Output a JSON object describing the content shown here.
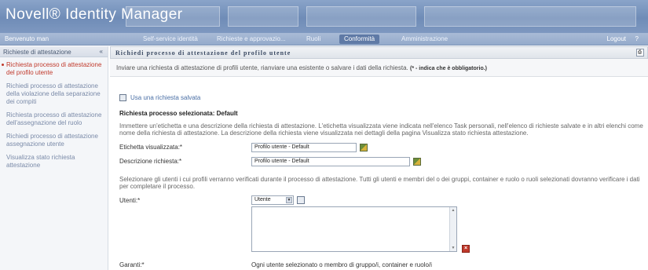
{
  "app": {
    "title": "Novell® Identity Manager"
  },
  "nav": {
    "welcome": "Benvenuto man",
    "tabs": [
      "Self-service identità",
      "Richieste e approvazio...",
      "Ruoli",
      "Conformità",
      "Amministrazione"
    ],
    "active_tab_index": 3,
    "logout": "Logout",
    "help": "?"
  },
  "sidebar": {
    "title": "Richieste di attestazione",
    "collapse": "«",
    "items": [
      {
        "label": "Richiesta processo di attestazione del profilo utente",
        "active": true
      },
      {
        "label": "Richiedi processo di attestazione della violazione della separazione dei compiti",
        "active": false
      },
      {
        "label": "Richiesta processo di attestazione dell'assegnazione del ruolo",
        "active": false
      },
      {
        "label": "Richiedi processo di attestazione assegnazione utente",
        "active": false
      },
      {
        "label": "Visualizza stato richiesta attestazione",
        "active": false
      }
    ]
  },
  "main": {
    "title": "Richiedi processo di attestazione del profilo utente",
    "intro": "Inviare una richiesta di attestazione di profili utente, rianviare una esistente o salvare i dati della richiesta.",
    "required_note": "(* - indica che è obbligatorio.)",
    "use_saved": "Usa una richiesta salvata",
    "selected_process": "Richiesta processo selezionata: Default",
    "desc1": "Immettere un'etichetta e una descrizione della richiesta di attestazione. L'etichetta visualizzata viene indicata nell'elenco Task personali, nell'elenco di richieste salvate e in altri elenchi come nome della richiesta di attestazione. La descrizione della richiesta viene visualizzata nei dettagli della pagina Visualizza stato richiesta attestazione.",
    "label_display": "Etichetta visualizzata:*",
    "label_display_value": "Profilo utente - Default",
    "label_desc": "Descrizione richiesta:*",
    "label_desc_value": "Profilo utente - Default",
    "desc2": "Selezionare gli utenti i cui profili verranno verificati durante il processo di attestazione. Tutti gli utenti e membri del o dei gruppi, container e ruolo o ruoli selezionati dovranno verificare i dati per completare il processo.",
    "label_users": "Utenti:*",
    "users_select": "Utente",
    "label_garanti": "Garanti:*",
    "garanti_value": "Ogni utente selezionato o membro di gruppo/i, container e ruolo/i"
  }
}
